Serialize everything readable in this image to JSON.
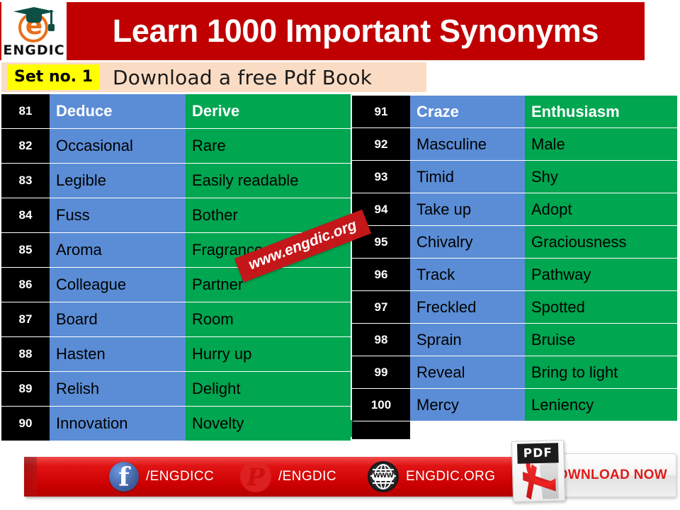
{
  "header": {
    "title": "Learn 1000 Important Synonyms",
    "logo_text": "ENGDIC",
    "logo_icon": "graduation-cap-e-logo",
    "band_color": "#c00000"
  },
  "subtitle": {
    "set_label": "Set no. 1",
    "text": "Download a free Pdf Book",
    "badge_color": "#ffff00",
    "bar_color": "#fadcc4"
  },
  "watermark": {
    "text": "www.engdic.org",
    "color": "#c4171a"
  },
  "colors": {
    "number_cell": "#000000",
    "word_cell": "#5b8dd6",
    "synonym_cell": "#00a650",
    "footer_red": "#cc0000"
  },
  "tables": {
    "left": {
      "rows": [
        {
          "no": "81",
          "word": "Deduce",
          "synonym": "Derive"
        },
        {
          "no": "82",
          "word": "Occasional",
          "synonym": "Rare"
        },
        {
          "no": "83",
          "word": "Legible",
          "synonym": "Easily readable"
        },
        {
          "no": "84",
          "word": "Fuss",
          "synonym": "Bother"
        },
        {
          "no": "85",
          "word": "Aroma",
          "synonym": "Fragrance"
        },
        {
          "no": "86",
          "word": "Colleague",
          "synonym": "Partner"
        },
        {
          "no": "87",
          "word": "Board",
          "synonym": "Room"
        },
        {
          "no": "88",
          "word": "Hasten",
          "synonym": "Hurry up"
        },
        {
          "no": "89",
          "word": "Relish",
          "synonym": "Delight"
        },
        {
          "no": "90",
          "word": "Innovation",
          "synonym": "Novelty"
        }
      ]
    },
    "right": {
      "rows": [
        {
          "no": "91",
          "word": "Craze",
          "synonym": "Enthusiasm"
        },
        {
          "no": "92",
          "word": "Masculine",
          "synonym": "Male"
        },
        {
          "no": "93",
          "word": "Timid",
          "synonym": "Shy"
        },
        {
          "no": "94",
          "word": "Take up",
          "synonym": "Adopt"
        },
        {
          "no": "95",
          "word": "Chivalry",
          "synonym": "Graciousness"
        },
        {
          "no": "96",
          "word": "Track",
          "synonym": "Pathway"
        },
        {
          "no": "97",
          "word": "Freckled",
          "synonym": "Spotted"
        },
        {
          "no": "98",
          "word": "Sprain",
          "synonym": "Bruise"
        },
        {
          "no": "99",
          "word": "Reveal",
          "synonym": "Bring to light"
        },
        {
          "no": "100",
          "word": "Mercy",
          "synonym": "Leniency"
        }
      ]
    }
  },
  "footer": {
    "facebook": {
      "icon": "facebook-icon",
      "label": "/ENGDICC"
    },
    "pinterest": {
      "icon": "pinterest-icon",
      "label": "/ENGDIC"
    },
    "website": {
      "icon": "globe-www-icon",
      "label": "ENGDIC.ORG"
    },
    "download": {
      "icon": "pdf-file-icon",
      "badge": "PDF",
      "label": "DOWNLOAD NOW"
    }
  }
}
